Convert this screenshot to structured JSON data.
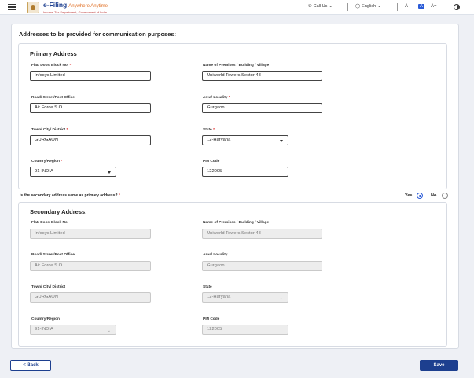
{
  "header": {
    "logo_main": "e-Filing",
    "logo_hindi": "Anywhere Anytime",
    "logo_sub": "Income Tax Department, Government of India",
    "call_us": "Call Us",
    "language": "English",
    "font_small": "A-",
    "font_normal": "A",
    "font_large": "A+"
  },
  "page": {
    "section_title": "Addresses to be provided for communication purposes:"
  },
  "primary": {
    "title": "Primary Address",
    "flat_label": "Flat/ Door/ Block No.",
    "flat_value": "Infosys Limited",
    "premises_label": "Name of Premises / Building / Village",
    "premises_value": "Uniworld Towers,Sector 48",
    "road_label": "Road/ Street/Post Office",
    "road_value": "Air Force S.O",
    "area_label": "Area/ Locality",
    "area_value": "Gurgaon",
    "town_label": "Town/ City/ District",
    "town_value": "GURGAON",
    "state_label": "State",
    "state_value": "12-Haryana",
    "country_label": "Country/Region",
    "country_value": "91-INDIA",
    "pin_label": "PIN Code",
    "pin_value": "122005"
  },
  "question": {
    "text": "Is the secondary address same as primary address?",
    "yes": "Yes",
    "no": "No"
  },
  "secondary": {
    "title": "Secondary Address:",
    "flat_label": "Flat/ Door/ Block No.",
    "flat_value": "Infosys Limited",
    "premises_label": "Name of Premises / Building / Village",
    "premises_value": "Uniworld Towers,Sector 48",
    "road_label": "Road/ Street/Post Office",
    "road_value": "Air Force S.O",
    "area_label": "Area/ Locality",
    "area_value": "Gurgaon",
    "town_label": "Town/ City/ District",
    "town_value": "GURGAON",
    "state_label": "State",
    "state_value": "12-Haryana",
    "country_label": "Country/Region",
    "country_value": "91-INDIA",
    "pin_label": "PIN Code",
    "pin_value": "122005"
  },
  "footer": {
    "back_label": "< Back",
    "save_label": "Save"
  },
  "colors": {
    "accent": "#1d3f8f",
    "radio_selected": "#2b5bd7",
    "required": "#dd2222"
  }
}
